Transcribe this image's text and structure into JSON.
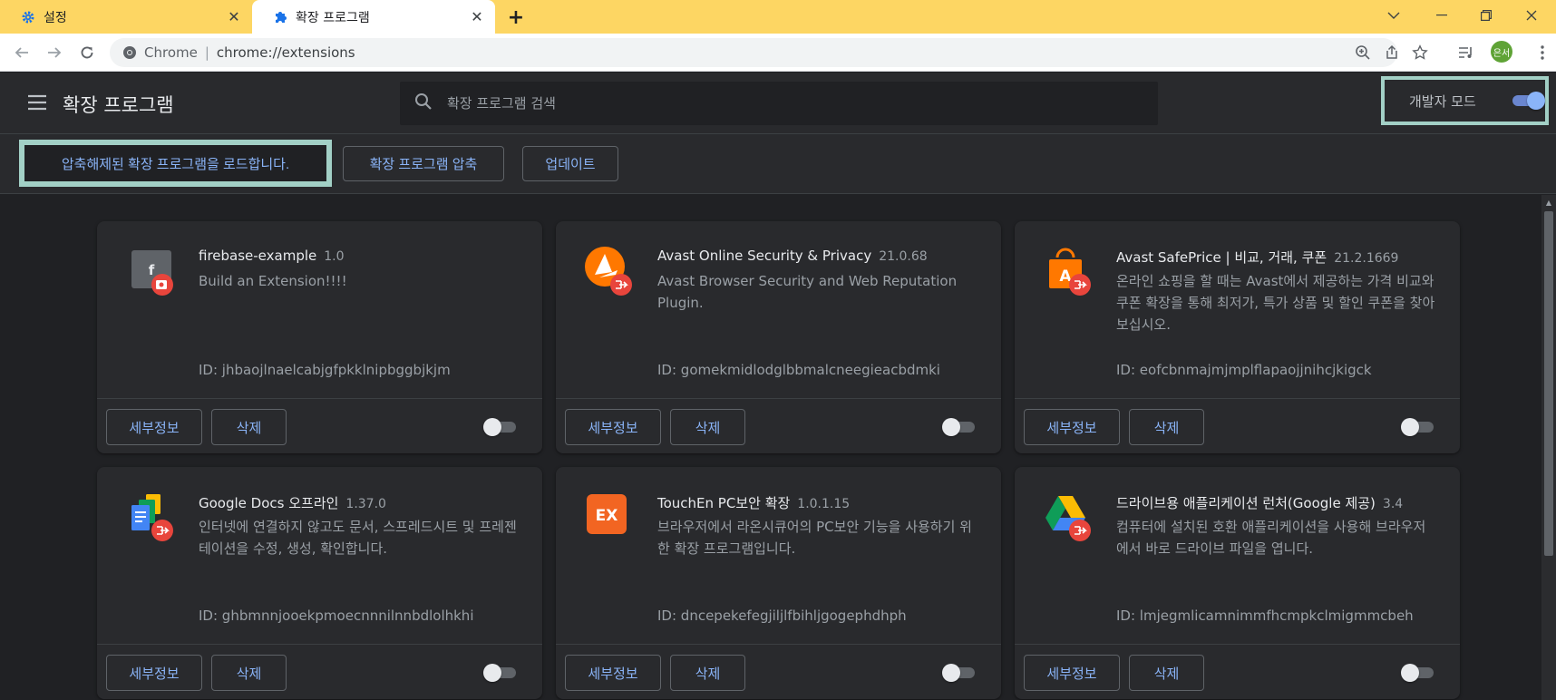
{
  "tabs": [
    {
      "title": "설정",
      "icon": "gear-icon"
    },
    {
      "title": "확장 프로그램",
      "icon": "puzzle-icon"
    }
  ],
  "address": {
    "scheme_label": "Chrome",
    "url": "chrome://extensions"
  },
  "profile": {
    "initials": "은서"
  },
  "header": {
    "title": "확장 프로그램",
    "search_placeholder": "확장 프로그램 검색",
    "dev_mode_label": "개발자 모드",
    "dev_mode_on": true
  },
  "dev_toolbar": {
    "load_unpacked": "압축해제된 확장 프로그램을 로드합니다.",
    "pack": "확장 프로그램 압축",
    "update": "업데이트"
  },
  "card_labels": {
    "details": "세부정보",
    "remove": "삭제"
  },
  "extensions": [
    {
      "name": "firebase-example",
      "version": "1.0",
      "description": "Build an Extension!!!!",
      "id_text": "ID: jhbaojlnaelcabjgfpkklnipbggbjkjm",
      "icon": "firebase-example-icon",
      "enabled": false
    },
    {
      "name": "Avast Online Security & Privacy",
      "version": "21.0.68",
      "description": "Avast Browser Security and Web Reputation Plugin.",
      "id_text": "ID: gomekmidlodglbbmalcneegieacbdmki",
      "icon": "avast-icon",
      "enabled": false
    },
    {
      "name": "Avast SafePrice | 비교, 거래, 쿠폰",
      "version": "21.2.1669",
      "description": "온라인 쇼핑을 할 때는 Avast에서 제공하는 가격 비교와 쿠폰 확장을 통해 최저가, 특가 상품 및 할인 쿠폰을 찾아보십시오.",
      "id_text": "ID: eofcbnmajmjmplflapaojjnihcjkigck",
      "icon": "shopping-bag-icon",
      "enabled": false
    },
    {
      "name": "Google Docs 오프라인",
      "version": "1.37.0",
      "description": "인터넷에 연결하지 않고도 문서, 스프레드시트 및 프레젠테이션을 수정, 생성, 확인합니다.",
      "id_text": "ID: ghbmnnjooekpmoecnnnilnnbdlolhkhi",
      "icon": "google-docs-icon",
      "enabled": false
    },
    {
      "name": "TouchEn PC보안 확장",
      "version": "1.0.1.15",
      "description": "브라우저에서 라온시큐어의 PC보안 기능을 사용하기 위한 확장 프로그램입니다.",
      "id_text": "ID: dncepekefegjiljlfbihljgogephdhph",
      "icon": "touchen-icon",
      "enabled": false
    },
    {
      "name": "드라이브용 애플리케이션 런처(Google 제공)",
      "version": "3.4",
      "description": "컴퓨터에 설치된 호환 애플리케이션을 사용해 브라우저에서 바로 드라이브 파일을 엽니다.",
      "id_text": "ID: lmjegmlicamnimmfhcmpkclmigmmcbeh",
      "icon": "google-drive-icon",
      "enabled": false
    }
  ],
  "colors": {
    "accent": "#8ab4f8",
    "highlight": "#a2d0c6",
    "tab_bar": "#fdd663",
    "badge": "#e8453c"
  }
}
